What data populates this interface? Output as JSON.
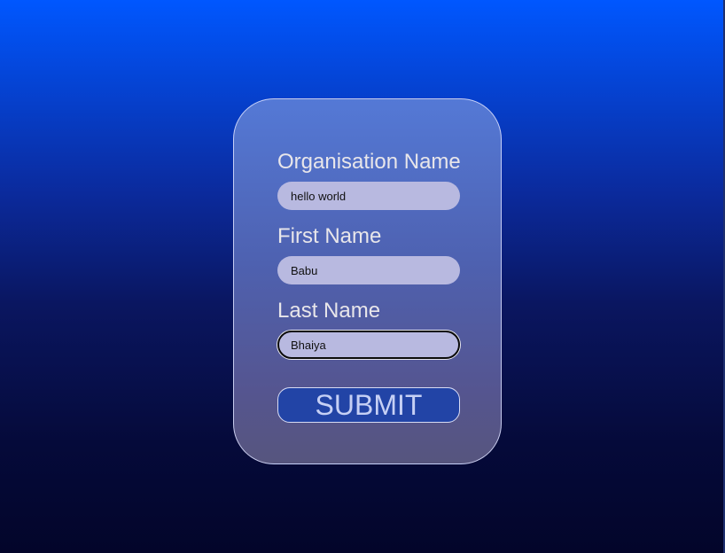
{
  "form": {
    "organisation": {
      "label": "Organisation Name",
      "value": "hello world"
    },
    "first_name": {
      "label": "First Name",
      "value": "Babu"
    },
    "last_name": {
      "label": "Last Name",
      "value": "Bhaiya"
    },
    "submit_label": "SUBMIT"
  },
  "colors": {
    "background_top": "#0057ff",
    "background_bottom": "#03052a",
    "card_top": "#5479d6",
    "card_bottom": "#56557e",
    "input_fill": "#b8b9e0",
    "button_fill": "#2244a6",
    "button_text": "#c6d0f5"
  }
}
